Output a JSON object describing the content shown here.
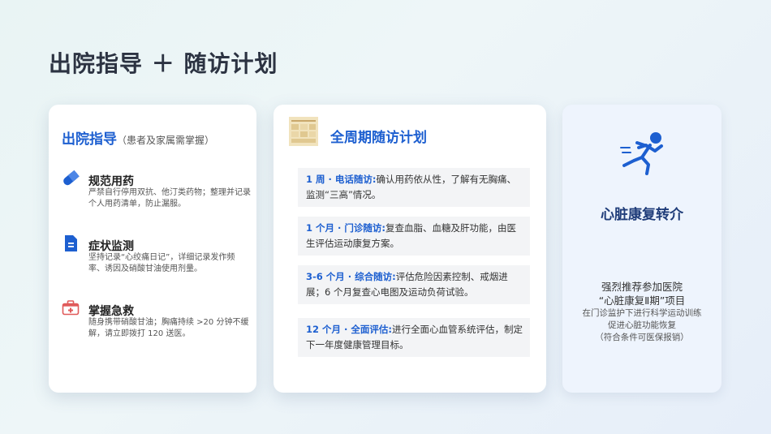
{
  "page": {
    "title": "出院指导 ＋ 随访计划"
  },
  "discharge": {
    "heading": "出院指导",
    "subheading": "（患者及家属需掌握）",
    "items": [
      {
        "icon": "pill-icon",
        "title": "规范用药",
        "desc": "严禁自行停用双抗、他汀类药物；整理并记录个人用药清单，防止漏服。"
      },
      {
        "icon": "document-icon",
        "title": "症状监测",
        "desc": "坚持记录“心绞痛日记”，详细记录发作频率、诱因及硝酸甘油使用剂量。"
      },
      {
        "icon": "first-aid-icon",
        "title": "掌握急救",
        "desc": "随身携带硝酸甘油；胸痛持续 >20 分钟不缓解，请立即拨打 120 送医。"
      }
    ]
  },
  "followup": {
    "heading": "全周期随访计划",
    "plans": [
      {
        "tag": "1 周 · 电话随访:",
        "text": "确认用药依从性，了解有无胸痛、监测“三高”情况。"
      },
      {
        "tag": "1 个月 · 门诊随访:",
        "text": "复查血脂、血糖及肝功能，由医生评估运动康复方案。"
      },
      {
        "tag": "3-6 个月 · 综合随访:",
        "text": "评估危险因素控制、戒烟进展；6 个月复查心电图及运动负荷试验。"
      },
      {
        "tag": "12 个月 · 全面评估:",
        "text": "进行全面心血管系统评估，制定下一年度健康管理目标。"
      }
    ]
  },
  "rehab": {
    "icon": "running-person-icon",
    "heading": "心脏康复转介",
    "line1": "强烈推荐参加医院",
    "line2": "“心脏康复Ⅱ期”项目",
    "line3": "在门诊监护下进行科学运动训练",
    "line4": "促进心脏功能恢复",
    "line5": "（符合条件可医保报销）"
  },
  "colors": {
    "accent": "#1d5fd0",
    "title": "#2c3342",
    "first_aid": "#e05a5a"
  }
}
